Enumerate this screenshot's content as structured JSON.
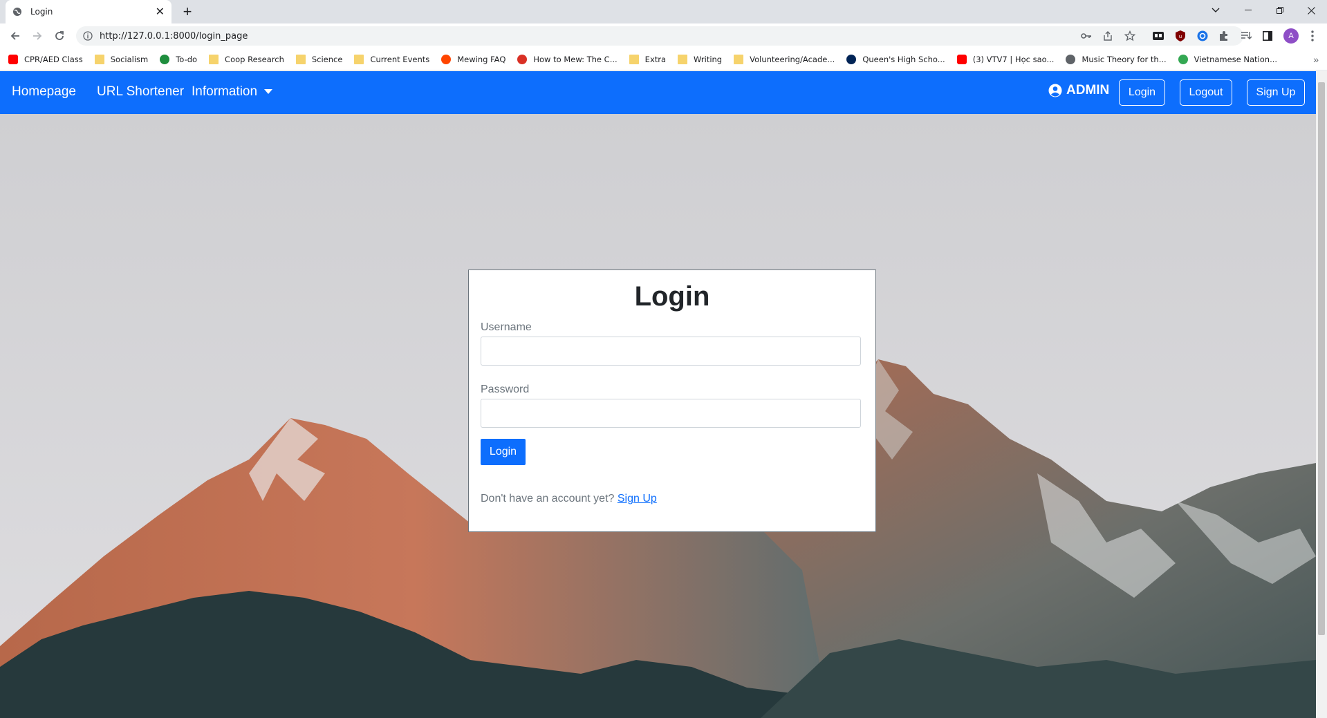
{
  "browser": {
    "tab_title": "Login",
    "url": "http://127.0.0.1:8000/login_page",
    "profile_initial": "A",
    "bookmarks": [
      {
        "label": "CPR/AED Class",
        "icon": "youtube-icon",
        "color": "#ff0000"
      },
      {
        "label": "Socialism",
        "icon": "folder-icon",
        "color": "#f6d36c"
      },
      {
        "label": "To-do",
        "icon": "classroom-icon",
        "color": "#1e8e3e"
      },
      {
        "label": "Coop Research",
        "icon": "folder-icon",
        "color": "#f6d36c"
      },
      {
        "label": "Science",
        "icon": "folder-icon",
        "color": "#f6d36c"
      },
      {
        "label": "Current Events",
        "icon": "folder-icon",
        "color": "#f6d36c"
      },
      {
        "label": "Mewing FAQ",
        "icon": "reddit-icon",
        "color": "#ff4500"
      },
      {
        "label": "How to Mew: The C...",
        "icon": "site-icon",
        "color": "#d93025"
      },
      {
        "label": "Extra",
        "icon": "folder-icon",
        "color": "#f6d36c"
      },
      {
        "label": "Writing",
        "icon": "folder-icon",
        "color": "#f6d36c"
      },
      {
        "label": "Volunteering/Acade...",
        "icon": "folder-icon",
        "color": "#f6d36c"
      },
      {
        "label": "Queen's High Scho...",
        "icon": "powershell-icon",
        "color": "#012456"
      },
      {
        "label": "(3) VTV7 | Học sao...",
        "icon": "youtube-icon",
        "color": "#ff0000"
      },
      {
        "label": "Music Theory for th...",
        "icon": "globe-icon",
        "color": "#5f6368"
      },
      {
        "label": "Vietnamese Nation...",
        "icon": "drive-icon",
        "color": "#34a853"
      }
    ]
  },
  "navbar": {
    "brand": "Homepage",
    "link_shortener": "URL Shortener",
    "link_information": "Information",
    "user_label": "ADMIN",
    "login_btn": "Login",
    "logout_btn": "Logout",
    "signup_btn": "Sign Up",
    "bg_color": "#0d6efd"
  },
  "login_card": {
    "title": "Login",
    "username_label": "Username",
    "username_value": "",
    "password_label": "Password",
    "password_value": "",
    "submit_label": "Login",
    "signup_prompt": "Don't have an account yet?",
    "signup_link": "Sign Up"
  }
}
